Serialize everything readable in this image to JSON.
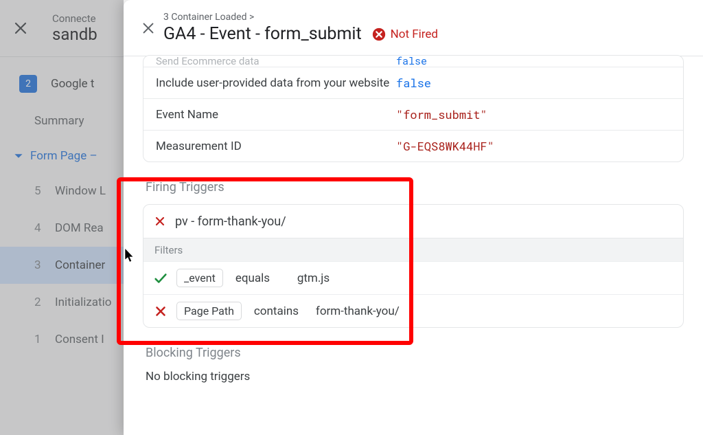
{
  "back": {
    "subtitle": "Connecte",
    "title": "sandb",
    "badge": "2",
    "workspace": "Google t",
    "summary": "Summary",
    "group": "Form Page –",
    "events": [
      {
        "n": "5",
        "label": "Window L"
      },
      {
        "n": "4",
        "label": "DOM Rea"
      },
      {
        "n": "3",
        "label": "Container",
        "selected": true
      },
      {
        "n": "2",
        "label": "Initializatio"
      },
      {
        "n": "1",
        "label": "Consent I"
      }
    ]
  },
  "front": {
    "breadcrumb": "3 Container Loaded >",
    "title": "GA4 - Event - form_submit",
    "status": "Not Fired",
    "params": [
      {
        "label": "Send Ecommerce data",
        "value": "false",
        "faded": true
      },
      {
        "label": "Include user-provided data from your website",
        "value": "false"
      },
      {
        "label": "Event Name",
        "value": "\"form_submit\""
      },
      {
        "label": "Measurement ID",
        "value": "\"G-EQS8WK44HF\""
      }
    ],
    "firing_triggers_title": "Firing Triggers",
    "trigger_name": "pv - form-thank-you/",
    "filters_label": "Filters",
    "filters": [
      {
        "pass": true,
        "field": "_event",
        "op": "equals",
        "val": "gtm.js"
      },
      {
        "pass": false,
        "field": "Page Path",
        "op": "contains",
        "val": "form-thank-you/"
      }
    ],
    "blocking_title": "Blocking Triggers",
    "blocking_text": "No blocking triggers"
  }
}
